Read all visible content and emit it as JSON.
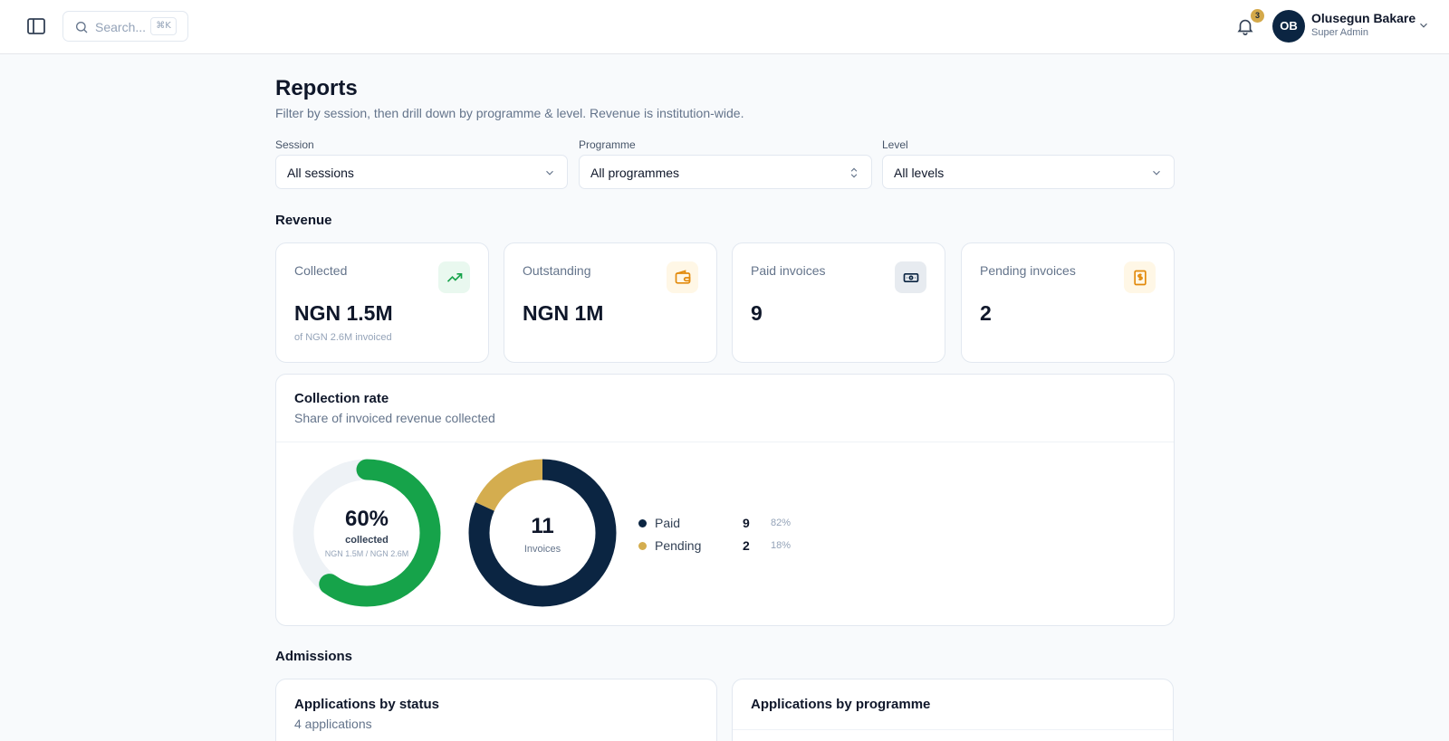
{
  "topbar": {
    "search_placeholder": "Search...",
    "search_shortcut": "⌘K",
    "notification_count": "3",
    "user": {
      "initials": "OB",
      "name": "Olusegun Bakare",
      "role": "Super Admin"
    }
  },
  "page": {
    "title": "Reports",
    "subtitle": "Filter by session, then drill down by programme & level. Revenue is institution-wide."
  },
  "filters": {
    "session": {
      "label": "Session",
      "value": "All sessions"
    },
    "programme": {
      "label": "Programme",
      "value": "All programmes"
    },
    "level": {
      "label": "Level",
      "value": "All levels"
    }
  },
  "revenue": {
    "section_title": "Revenue",
    "cards": [
      {
        "label": "Collected",
        "value": "NGN 1.5M",
        "sub": "of NGN 2.6M invoiced",
        "icon": "trending-up-icon"
      },
      {
        "label": "Outstanding",
        "value": "NGN 1M",
        "icon": "wallet-icon"
      },
      {
        "label": "Paid invoices",
        "value": "9",
        "icon": "banknote-icon"
      },
      {
        "label": "Pending invoices",
        "value": "2",
        "icon": "receipt-icon"
      }
    ]
  },
  "collection_rate": {
    "title": "Collection rate",
    "subtitle": "Share of invoiced revenue collected",
    "percent": 60,
    "percent_label": "60%",
    "collected_label": "collected",
    "amounts_label": "NGN 1.5M / NGN 2.6M",
    "invoices_total": "11",
    "invoices_label": "Invoices",
    "legend": [
      {
        "name": "Paid",
        "count": "9",
        "pct": "82%",
        "color": "#0b2542"
      },
      {
        "name": "Pending",
        "count": "2",
        "pct": "18%",
        "color": "#d4ad4f"
      }
    ]
  },
  "admissions": {
    "section_title": "Admissions",
    "by_status": {
      "title": "Applications by status",
      "subtitle": "4 applications"
    },
    "by_programme": {
      "title": "Applications by programme"
    }
  },
  "colors": {
    "collected_green": "#16a34a",
    "paid_navy": "#0b2542",
    "pending_gold": "#d4ad4f"
  }
}
